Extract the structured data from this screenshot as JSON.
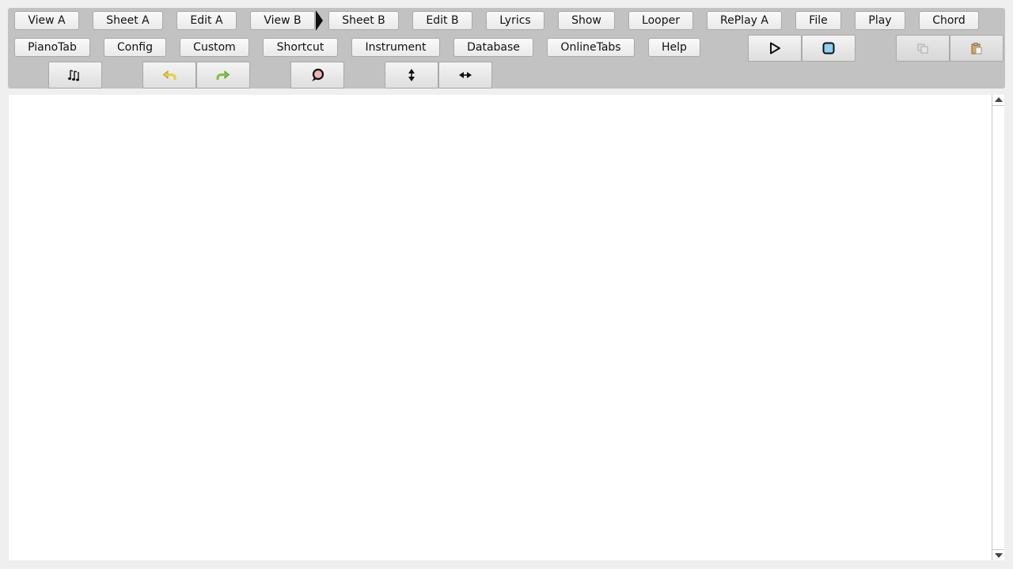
{
  "toolbar": {
    "row1": [
      "View A",
      "Sheet A",
      "Edit A",
      "View B",
      "Sheet B",
      "Edit B",
      "Lyrics",
      "Show",
      "Looper",
      "RePlay A",
      "File",
      "Play",
      "Chord"
    ],
    "row2": [
      "PianoTab",
      "Config",
      "Custom",
      "Shortcut",
      "Instrument",
      "Database",
      "OnlineTabs",
      "Help"
    ],
    "icons": {
      "play": "play-icon",
      "stop": "stop-icon",
      "copy": "copy-icon",
      "paste": "paste-icon",
      "notes": "music-notes-icon",
      "undo": "undo-icon",
      "redo": "redo-icon",
      "loop": "loop-icon",
      "vertical": "vertical-arrows-icon",
      "horizontal": "horizontal-arrows-icon"
    },
    "colors": {
      "toolbar_bg": "#c2c2c2",
      "stop_fill": "#8fd0f5",
      "undo_color": "#e8cf3a",
      "redo_color": "#7fc23c",
      "loop_accent": "#e58a8a"
    }
  }
}
